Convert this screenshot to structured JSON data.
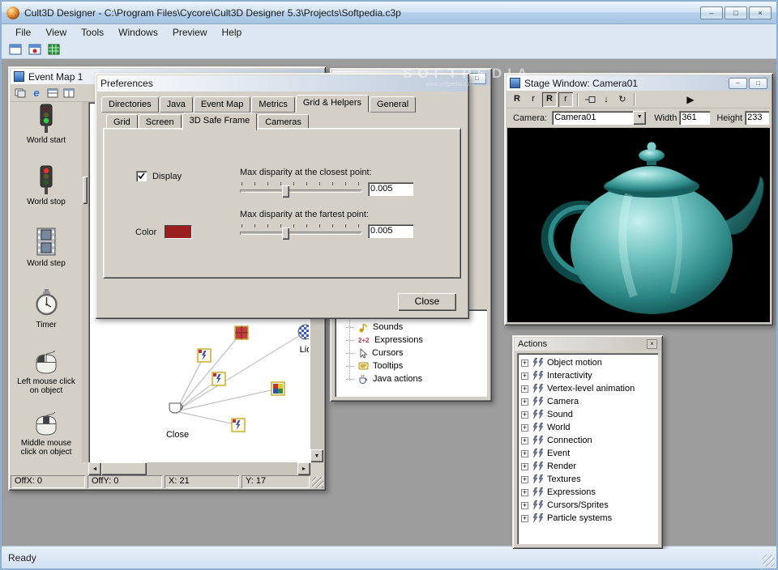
{
  "icons": {
    "minimize": "–",
    "maximize": "□",
    "close": "×",
    "combo_arrow": "▼",
    "play": "▶",
    "arrow_up": "▲",
    "arrow_down": "▼",
    "arrow_left": "◄",
    "arrow_right": "►",
    "plus": "+",
    "down_arrow": "↓",
    "rotate": "↻",
    "e_browser": "e"
  },
  "app": {
    "title": "Cult3D Designer - C:\\Program Files\\Cycore\\Cult3D Designer 5.3\\Projects\\Softpedia.c3p",
    "status_ready": "Ready"
  },
  "menu": {
    "items": [
      "File",
      "View",
      "Tools",
      "Windows",
      "Preview",
      "Help"
    ]
  },
  "watermark": {
    "line1": "SOFTPEDIA",
    "line2": "www.softpedia.com"
  },
  "event_map": {
    "title": "Event Map 1",
    "palette": [
      {
        "label": "World start"
      },
      {
        "label": "World stop"
      },
      {
        "label": "World step"
      },
      {
        "label": "Timer"
      },
      {
        "label": "Left mouse click on object"
      },
      {
        "label": "Middle mouse click on object"
      }
    ],
    "canvas": {
      "lid_label": "Lid",
      "close_label": "Close"
    },
    "status": {
      "offx": "OffX: 0",
      "offy": "OffY: 0",
      "x": "X: 21",
      "y": "Y: 17"
    }
  },
  "resources": {
    "items": [
      "Sounds",
      "Expressions",
      "Cursors",
      "Tooltips",
      "Java actions"
    ]
  },
  "preferences": {
    "title": "Preferences",
    "tabs": [
      "Directories",
      "Java",
      "Event Map",
      "Metrics",
      "Grid & Helpers",
      "General"
    ],
    "subtabs": [
      "Grid",
      "Screen",
      "3D Safe Frame",
      "Cameras"
    ],
    "display_checkbox": "Display",
    "color_label": "Color",
    "swatch_color": "#9a2020",
    "slider1_label": "Max disparity at the closest point:",
    "slider1_value": "0.005",
    "slider2_label": "Max disparity at the fartest point:",
    "slider2_value": "0.005",
    "close_button": "Close"
  },
  "stage": {
    "title": "Stage Window: Camera01",
    "buttons": [
      "R",
      "r",
      "R",
      "r"
    ],
    "camera_label": "Camera:",
    "camera_value": "Camera01",
    "width_label": "Width",
    "width_value": "361",
    "height_label": "Height",
    "height_value": "233"
  },
  "actions": {
    "title": "Actions",
    "items": [
      "Object motion",
      "Interactivity",
      "Vertex-level animation",
      "Camera",
      "Sound",
      "World",
      "Connection",
      "Event",
      "Render",
      "Textures",
      "Expressions",
      "Cursors/Sprites",
      "Particle systems"
    ]
  }
}
